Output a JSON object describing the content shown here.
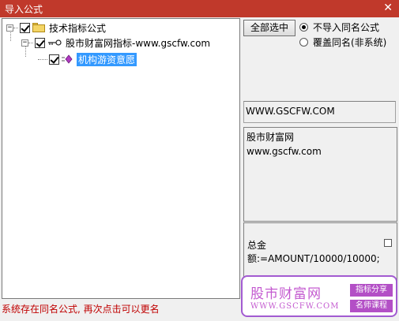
{
  "window": {
    "title": "导入公式",
    "close_glyph": "✕"
  },
  "tree": {
    "root_label": "技术指标公式",
    "group_label": "股市财富网指标-www.gscfw.com",
    "item_label": "机构游资意愿",
    "expander_glyph": "−"
  },
  "options": {
    "select_all_label": "全部选中",
    "radio_skip_label": "不导入同名公式",
    "radio_overwrite_label": "覆盖同名(非系统)",
    "selected_radio": "skip"
  },
  "detail": {
    "url": "WWW.GSCFW.COM",
    "desc_line1": "股市财富网",
    "desc_line2": "www.gscfw.com",
    "formula_line1": "总金",
    "formula_line2": "额:=AMOUNT/10000/10000;"
  },
  "watermark": {
    "brand": "股市财富网",
    "url": "WWW.GSCFW.COM",
    "tag1": "指标分享",
    "tag2": "名师课程"
  },
  "status": {
    "message": "系统存在同名公式, 再次点击可以更名"
  },
  "colors": {
    "titlebar": "#c0392b",
    "status_text": "#c00000",
    "selection": "#3399ff",
    "watermark": "#b34fc6"
  }
}
